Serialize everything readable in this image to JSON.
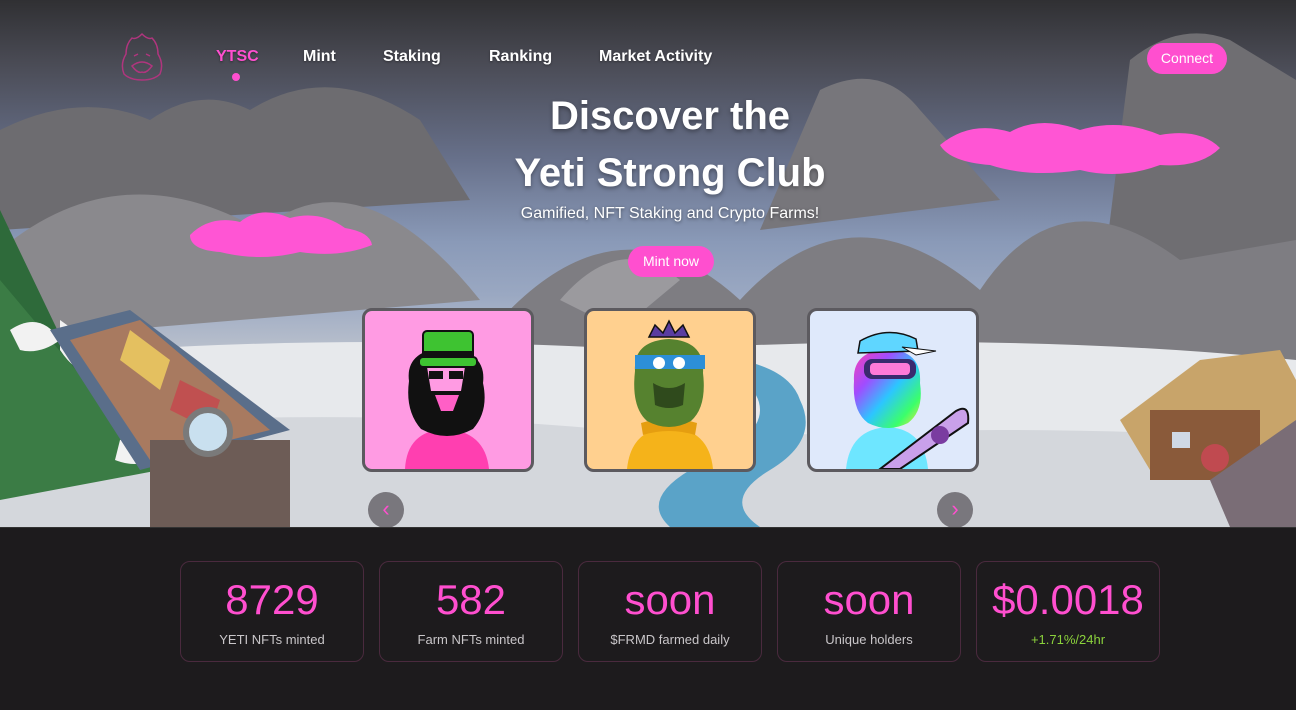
{
  "nav": {
    "items": [
      {
        "label": "YTSC",
        "active": true
      },
      {
        "label": "Mint"
      },
      {
        "label": "Staking"
      },
      {
        "label": "Ranking"
      },
      {
        "label": "Market Activity"
      }
    ],
    "connect_label": "Connect"
  },
  "hero": {
    "title_line1": "Discover the",
    "title_line2": "Yeti Strong Club",
    "subtitle": "Gamified, NFT Staking and Crypto Farms!",
    "mint_label": "Mint now"
  },
  "carousel": {
    "cards": [
      {
        "background": "#ff9be3",
        "hat": "green-top-hat"
      },
      {
        "background": "#ffd08f",
        "hat": "purple-crown"
      },
      {
        "background": "#dfe9fb",
        "hat": "blue-cap"
      }
    ],
    "prev_icon": "chevron-left-icon",
    "next_icon": "chevron-right-icon"
  },
  "stats": [
    {
      "value": "8729",
      "label": "YETI NFTs minted"
    },
    {
      "value": "582",
      "label": "Farm NFTs minted"
    },
    {
      "value": "soon",
      "label": "$FRMD farmed daily"
    },
    {
      "value": "soon",
      "label": "Unique holders"
    },
    {
      "value": "$0.0018",
      "change": "+1.71%/24hr"
    }
  ],
  "colors": {
    "accent": "#ff4fcf",
    "positive": "#8bd23c",
    "background": "#1d1b1d"
  }
}
